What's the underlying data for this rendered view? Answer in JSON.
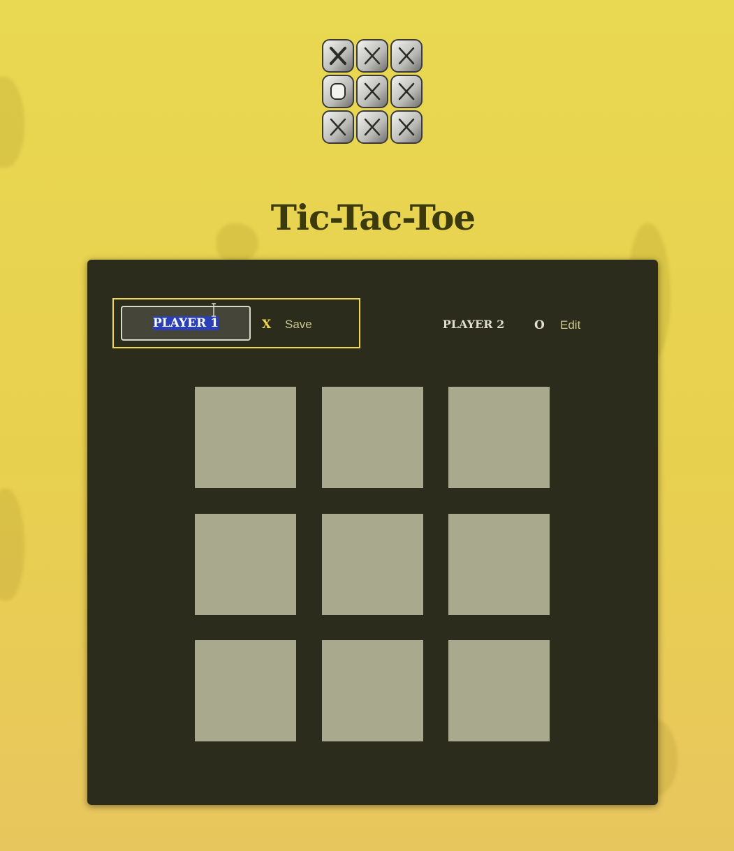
{
  "app": {
    "title": "Tic-Tac-Toe"
  },
  "players": [
    {
      "name": "PLAYER 1",
      "symbol": "X",
      "action_label": "Save",
      "editing": true,
      "active": true
    },
    {
      "name": "PLAYER 2",
      "symbol": "O",
      "action_label": "Edit",
      "editing": false,
      "active": false
    }
  ],
  "board": {
    "cells": [
      "",
      "",
      "",
      "",
      "",
      "",
      "",
      "",
      ""
    ]
  },
  "colors": {
    "background": "#e9d851",
    "board": "#2c2c1c",
    "cell": "#a9a98d",
    "active_highlight": "#f0d84e",
    "title": "#3b3a0c",
    "selection": "#2b3fb7"
  },
  "icons": {
    "logo": "tic-tac-toe-dice-logo-icon",
    "cursor": "text-cursor-icon"
  }
}
